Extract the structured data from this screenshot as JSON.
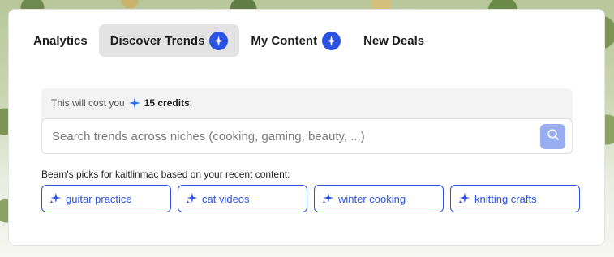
{
  "tabs": [
    {
      "label": "Analytics",
      "active": false,
      "badge": false
    },
    {
      "label": "Discover Trends",
      "active": true,
      "badge": true
    },
    {
      "label": "My Content",
      "active": false,
      "badge": true
    },
    {
      "label": "New Deals",
      "active": false,
      "badge": false
    }
  ],
  "cost": {
    "prefix": "This will cost you",
    "credits": "15 credits",
    "suffix": "."
  },
  "search": {
    "placeholder": "Search trends across niches (cooking, gaming, beauty, ...)",
    "value": ""
  },
  "picks": {
    "label": "Beam's picks for kaitlinmac based on your recent content:",
    "items": [
      "guitar practice",
      "cat videos",
      "winter cooking",
      "knitting crafts"
    ]
  },
  "colors": {
    "accent": "#2b52e0",
    "search_button": "#98aef0",
    "active_tab": "#e3e3e3"
  },
  "icons": {
    "badge": "sparkle-icon",
    "search": "search-icon"
  }
}
